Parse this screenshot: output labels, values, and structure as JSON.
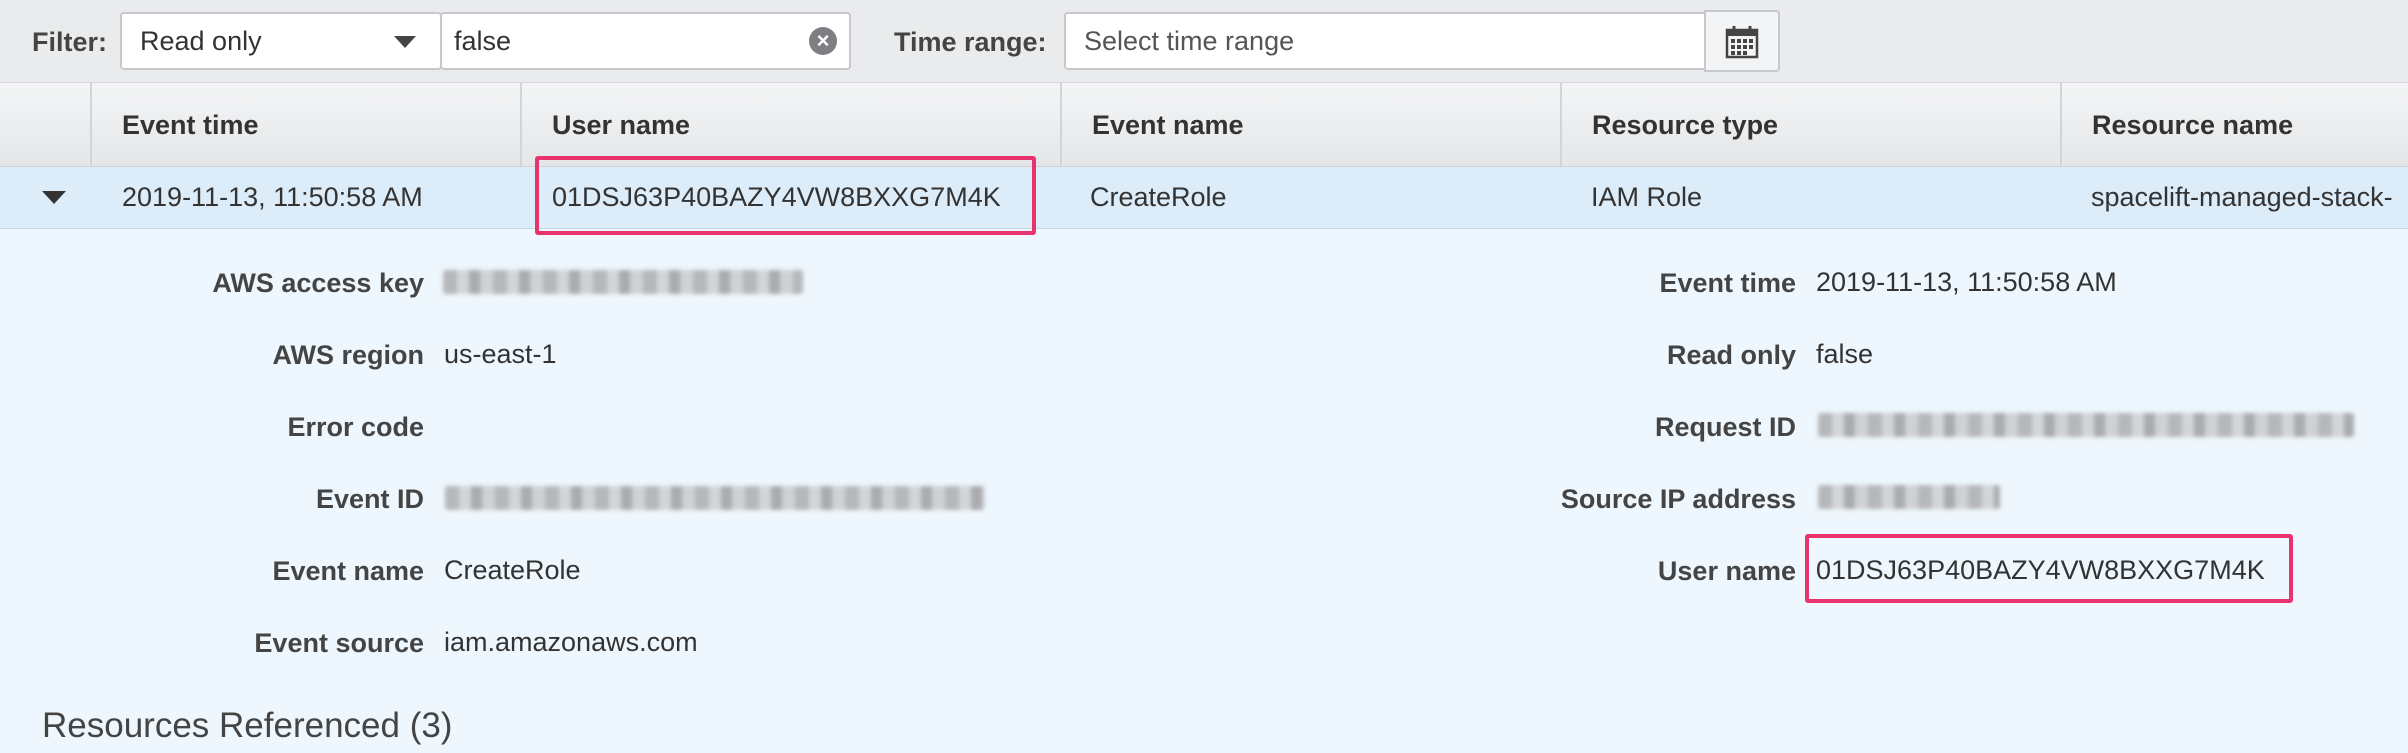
{
  "filter": {
    "label": "Filter:",
    "attribute_value": "Read only",
    "value": "false",
    "time_range_label": "Time range:",
    "time_range_placeholder": "Select time range"
  },
  "table": {
    "columns": [
      "Event time",
      "User name",
      "Event name",
      "Resource type",
      "Resource name"
    ],
    "row": {
      "event_time": "2019-11-13, 11:50:58 AM",
      "user_name": "01DSJ63P40BAZY4VW8BXXG7M4K",
      "event_name": "CreateRole",
      "resource_type": "IAM Role",
      "resource_name": "spacelift-managed-stack-"
    }
  },
  "details": {
    "left": [
      {
        "label": "AWS access key",
        "value": ""
      },
      {
        "label": "AWS region",
        "value": "us-east-1"
      },
      {
        "label": "Error code",
        "value": ""
      },
      {
        "label": "Event ID",
        "value": ""
      },
      {
        "label": "Event name",
        "value": "CreateRole"
      },
      {
        "label": "Event source",
        "value": "iam.amazonaws.com"
      }
    ],
    "right": [
      {
        "label": "Event time",
        "value": "2019-11-13, 11:50:58 AM"
      },
      {
        "label": "Read only",
        "value": "false"
      },
      {
        "label": "Request ID",
        "value": ""
      },
      {
        "label": "Source IP address",
        "value": ""
      },
      {
        "label": "User name",
        "value": "01DSJ63P40BAZY4VW8BXXG7M4K"
      }
    ]
  },
  "resources_heading": "Resources Referenced (3)",
  "colors": {
    "highlight": "#e8336d",
    "row_selected": "#dcecf8",
    "detail_background": "#eef7fd"
  }
}
